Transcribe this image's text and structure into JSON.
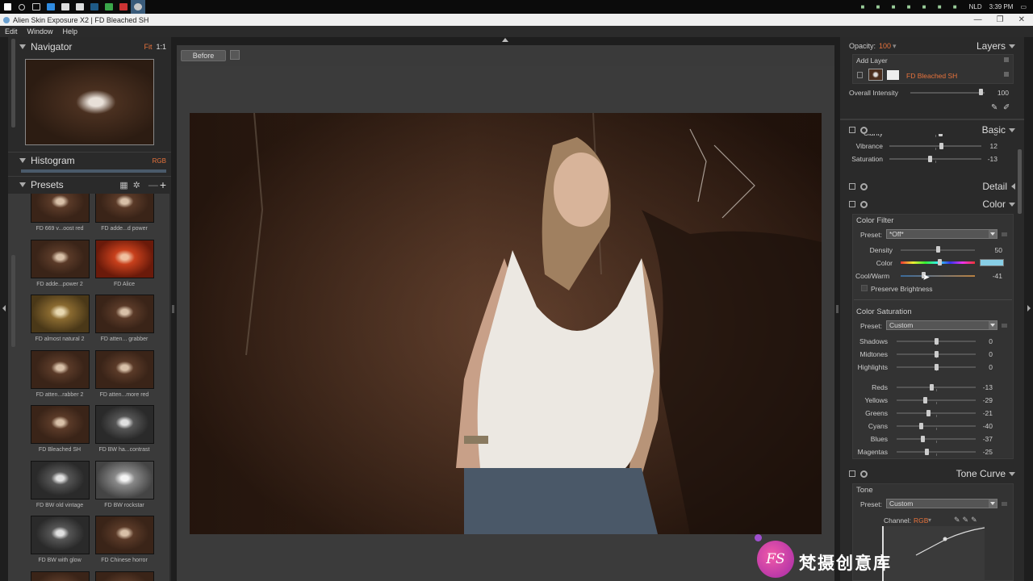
{
  "taskbar": {
    "clock": "3:39 PM",
    "language": "NLD"
  },
  "window": {
    "title": "Alien Skin Exposure X2 | FD Bleached SH"
  },
  "menu": [
    "Edit",
    "Window",
    "Help"
  ],
  "navigator": {
    "title": "Navigator",
    "fit": "Fit",
    "ratio": "1:1"
  },
  "histogram": {
    "title": "Histogram",
    "mode": "RGB"
  },
  "presets": {
    "title": "Presets",
    "items": [
      {
        "label": "FD 669 v...oost red",
        "tone": "warm"
      },
      {
        "label": "FD adde...d power",
        "tone": "warm"
      },
      {
        "label": "FD adde...power 2",
        "tone": "warm"
      },
      {
        "label": "FD Alice",
        "tone": "red"
      },
      {
        "label": "FD almost natural 2",
        "tone": "gold"
      },
      {
        "label": "FD atten... grabber",
        "tone": "warm"
      },
      {
        "label": "FD atten...rabber 2",
        "tone": "warm"
      },
      {
        "label": "FD atten...more red",
        "tone": "warm"
      },
      {
        "label": "FD Bleached SH",
        "tone": "warm"
      },
      {
        "label": "FD BW ha...contrast",
        "tone": "bw"
      },
      {
        "label": "FD BW old vintage",
        "tone": "bw"
      },
      {
        "label": "FD BW rockstar",
        "tone": "bwl"
      },
      {
        "label": "FD BW with glow",
        "tone": "bw"
      },
      {
        "label": "FD Chinese horror",
        "tone": "warm"
      }
    ]
  },
  "center": {
    "before_button": "Before"
  },
  "layers": {
    "opacity_label": "Opacity:",
    "opacity_value": "100",
    "title": "Layers",
    "add_layer": "Add Layer",
    "layer_name": "FD Bleached SH",
    "intensity_label": "Overall Intensity",
    "intensity_value": "100"
  },
  "basic": {
    "title": "Basic",
    "rows": [
      {
        "label": "Clarity",
        "value": "6",
        "pos": 0.55
      },
      {
        "label": "Vibrance",
        "value": "12",
        "pos": 0.56
      },
      {
        "label": "Saturation",
        "value": "-13",
        "pos": 0.44
      }
    ]
  },
  "detail": {
    "title": "Detail"
  },
  "color": {
    "title": "Color",
    "filter_title": "Color Filter",
    "preset_label": "Preset:",
    "preset_value": "*Off*",
    "density_label": "Density",
    "density_value": "50",
    "color_label": "Color",
    "coolwarm_label": "Cool/Warm",
    "coolwarm_value": "-41",
    "preserve_label": "Preserve Brightness",
    "swatch_color": "#88cfe6",
    "sat_title": "Color Saturation",
    "sat_preset_label": "Preset:",
    "sat_preset_value": "Custom",
    "tone_rows": [
      {
        "label": "Shadows",
        "value": "0",
        "pos": 0.5
      },
      {
        "label": "Midtones",
        "value": "0",
        "pos": 0.5
      },
      {
        "label": "Highlights",
        "value": "0",
        "pos": 0.5
      }
    ],
    "hue_rows": [
      {
        "label": "Reds",
        "value": "-13",
        "pos": 0.44
      },
      {
        "label": "Yellows",
        "value": "-29",
        "pos": 0.36
      },
      {
        "label": "Greens",
        "value": "-21",
        "pos": 0.4
      },
      {
        "label": "Cyans",
        "value": "-40",
        "pos": 0.31
      },
      {
        "label": "Blues",
        "value": "-37",
        "pos": 0.33
      },
      {
        "label": "Magentas",
        "value": "-25",
        "pos": 0.38
      }
    ]
  },
  "tonecurve": {
    "title": "Tone Curve",
    "tone_title": "Tone",
    "preset_label": "Preset:",
    "preset_value": "Custom",
    "channel_label": "Channel:",
    "channel_value": "RGB"
  },
  "watermark": {
    "text": "梵摄创意库",
    "logo": "FS"
  }
}
